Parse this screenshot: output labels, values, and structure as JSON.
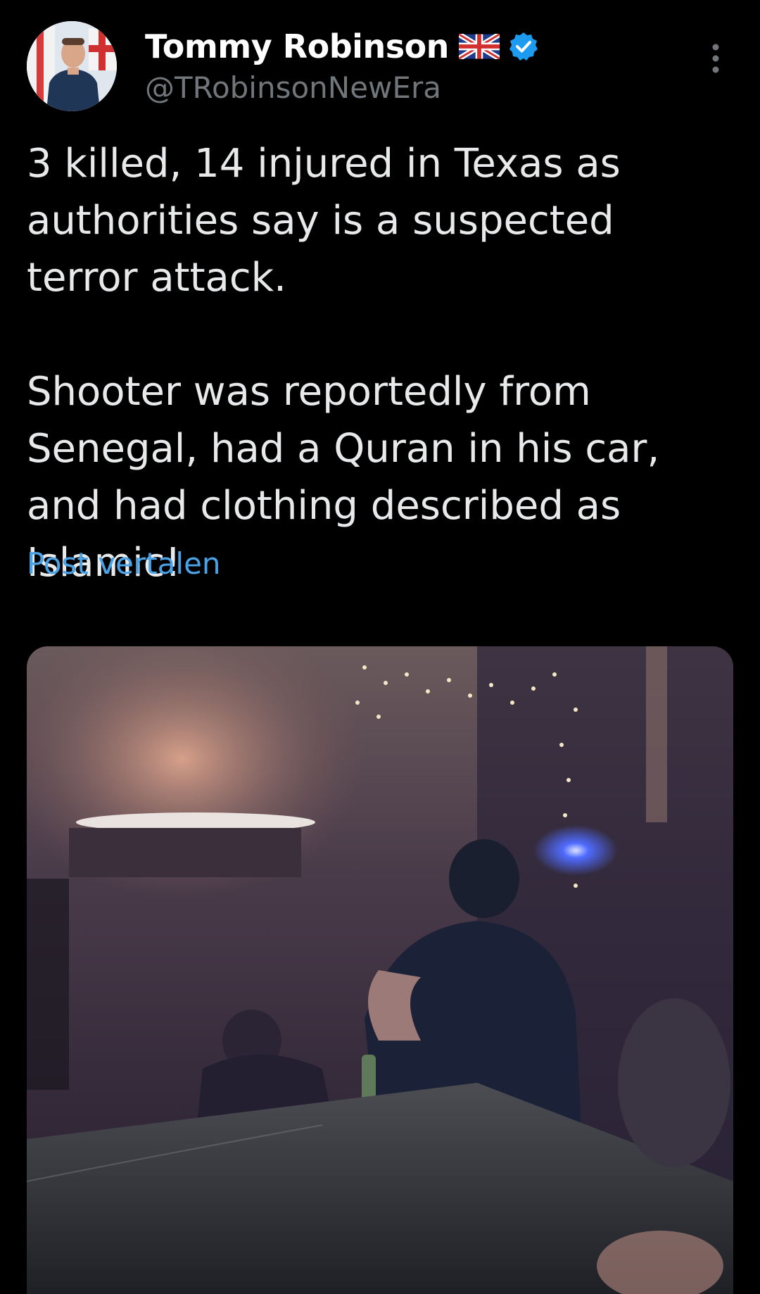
{
  "post": {
    "author": {
      "display_name": "Tommy Robinson",
      "handle": "@TRobinsonNewEra",
      "avatar": "profile-photo",
      "badges": [
        "uk-flag-icon",
        "verified-badge-icon"
      ]
    },
    "text_paragraph_1": "3 killed, 14 injured in Texas as authorities say is a suspected terror attack.",
    "text_paragraph_2": "Shooter was reportedly from Senegal, had a Quran in his car, and had clothing described as Islamic!",
    "translate_label": "Post vertalen",
    "menu_icon": "more-vertical-icon",
    "media": {
      "type": "video-still",
      "description_icon": "video-thumbnail"
    }
  },
  "colors": {
    "background": "#000000",
    "text_primary": "#e7e9ea",
    "text_secondary": "#71767b",
    "link": "#4aa3e6",
    "verified": "#1d9bf0"
  }
}
